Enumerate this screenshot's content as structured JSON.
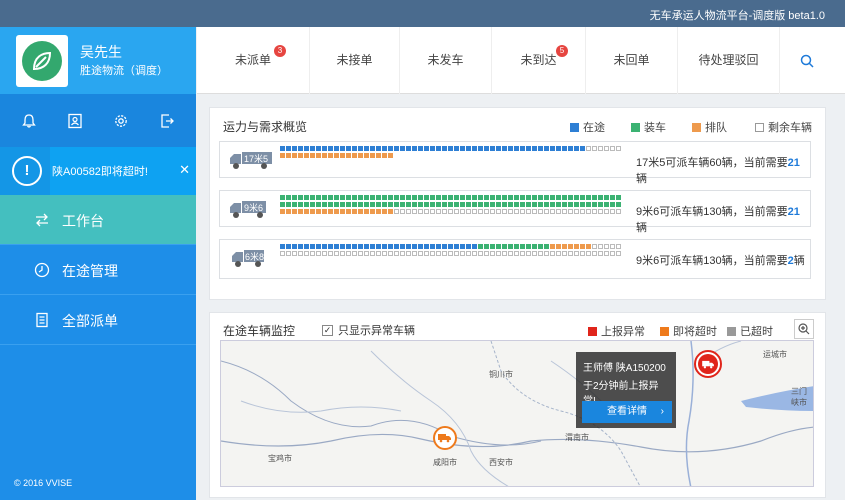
{
  "app_title": "无车承运人物流平台-调度版 beta1.0",
  "user": {
    "name": "吴先生",
    "company": "胜途物流（调度）"
  },
  "icons": [
    "bell-icon",
    "contact-icon",
    "gear-icon",
    "logout-icon"
  ],
  "alert": {
    "text": "陕A00582即将超时!",
    "close": "✕"
  },
  "nav": [
    {
      "label": "工作台",
      "active": true
    },
    {
      "label": "在途管理",
      "active": false
    },
    {
      "label": "全部派单",
      "active": false
    }
  ],
  "copyright": "© 2016 VVISE",
  "tabs": [
    {
      "label": "未派单",
      "badge": "3"
    },
    {
      "label": "未接单",
      "badge": ""
    },
    {
      "label": "未发车",
      "badge": ""
    },
    {
      "label": "未到达",
      "badge": "5"
    },
    {
      "label": "未回单",
      "badge": ""
    },
    {
      "label": "待处理驳回",
      "badge": ""
    }
  ],
  "capacity": {
    "title": "运力与需求概览",
    "legend": [
      {
        "label": "在途",
        "color": "#2e7fd4"
      },
      {
        "label": "装车",
        "color": "#3bb272"
      },
      {
        "label": "排队",
        "color": "#ee9a4d"
      },
      {
        "label": "剩余车辆",
        "color": "#ffffff"
      }
    ],
    "rows": [
      {
        "truck": "17米5",
        "text": "17米5可派车辆60辆，当前需要",
        "need": "21",
        "unit": "辆",
        "line1": {
          "blue": 51,
          "green": 0,
          "orange": 0,
          "empty": 6
        },
        "line2": {
          "blue": 0,
          "green": 0,
          "orange": 19,
          "empty": 0
        }
      },
      {
        "truck": "9米6",
        "text": "9米6可派车辆130辆，当前需要",
        "need": "21",
        "unit": "辆",
        "line1": {
          "blue": 0,
          "green": 57,
          "orange": 0,
          "empty": 0
        },
        "line2": {
          "blue": 0,
          "green": 57,
          "orange": 0,
          "empty": 0
        },
        "line3": {
          "blue": 0,
          "green": 0,
          "orange": 19,
          "empty": 38
        }
      },
      {
        "truck": "6米8",
        "text": "9米6可派车辆130辆，当前需要",
        "need": "2",
        "unit": "辆",
        "line1": {
          "blue": 33,
          "green": 0,
          "orange": 0,
          "empty": 0,
          "green2": 12,
          "orange2": 7,
          "empty2": 5
        },
        "line2": {
          "blue": 0,
          "green": 0,
          "orange": 0,
          "empty": 57
        },
        "line3": {
          "blue": 0,
          "green": 0,
          "orange": 0,
          "empty": 0
        }
      }
    ]
  },
  "monitor": {
    "title": "在途车辆监控",
    "checkbox_label": "只显示异常车辆",
    "legend": [
      {
        "label": "上报异常",
        "color": "#e0251b"
      },
      {
        "label": "即将超时",
        "color": "#ee7a1c"
      },
      {
        "label": "已超时",
        "color": "#999999"
      }
    ],
    "popup": {
      "line1": "王师傅 陕A150200",
      "line2": "于2分钟前上报异常!",
      "button": "查看详情"
    },
    "cities": [
      "铜川市",
      "渭南市",
      "咸阳市",
      "西安市",
      "宝鸡市",
      "运城市",
      "三门峡市"
    ]
  }
}
